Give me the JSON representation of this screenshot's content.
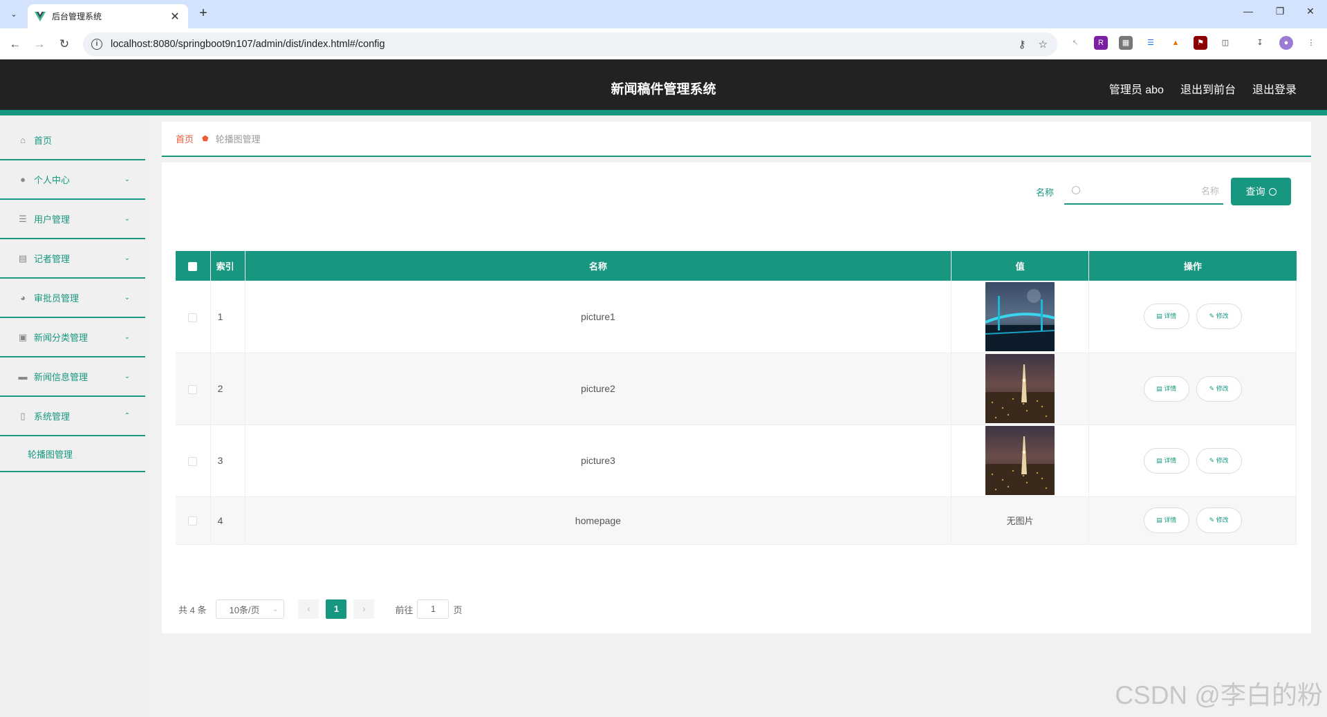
{
  "browser": {
    "tab_title": "后台管理系统",
    "url": "localhost:8080/springboot9n107/admin/dist/index.html#/config"
  },
  "header": {
    "title": "新闻稿件管理系统",
    "user": "管理员 abo",
    "to_front": "退出到前台",
    "logout": "退出登录"
  },
  "sidebar": {
    "items": [
      {
        "label": "首页",
        "icon": "home-icon"
      },
      {
        "label": "个人中心",
        "icon": "user-icon"
      },
      {
        "label": "用户管理",
        "icon": "list-icon"
      },
      {
        "label": "记者管理",
        "icon": "card-icon"
      },
      {
        "label": "审批员管理",
        "icon": "compass-icon"
      },
      {
        "label": "新闻分类管理",
        "icon": "briefcase-icon"
      },
      {
        "label": "新闻信息管理",
        "icon": "message-icon"
      },
      {
        "label": "系统管理",
        "icon": "phone-icon"
      }
    ],
    "submenu_label": "轮播图管理"
  },
  "breadcrumb": {
    "home": "首页",
    "current": "轮播图管理"
  },
  "search": {
    "label": "名称",
    "placeholder": "名称",
    "button": "查询"
  },
  "table": {
    "headers": [
      "索引",
      "名称",
      "值",
      "操作"
    ],
    "rows": [
      {
        "index": "1",
        "name": "picture1",
        "value": "",
        "detail": "详情",
        "edit": "修改"
      },
      {
        "index": "2",
        "name": "picture2",
        "value": "",
        "detail": "详情",
        "edit": "修改"
      },
      {
        "index": "3",
        "name": "picture3",
        "value": "",
        "detail": "详情",
        "edit": "修改"
      },
      {
        "index": "4",
        "name": "homepage",
        "value": "无图片",
        "detail": "详情",
        "edit": "修改"
      }
    ]
  },
  "pagination": {
    "total": "共 4 条",
    "page_size": "10条/页",
    "current_page": "1",
    "goto_label": "前往",
    "goto_value": "1",
    "page_unit": "页"
  },
  "watermark": "CSDN @李白的粉",
  "colors": {
    "primary": "#17977f",
    "header_bg": "#222222",
    "breadcrumb_home": "#ee5b36"
  }
}
